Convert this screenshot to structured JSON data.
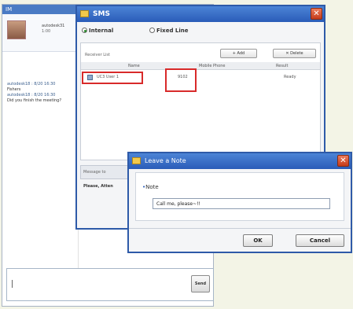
{
  "chat": {
    "title": "IM",
    "user_name": "autodesk31",
    "user_status": "1:00",
    "messages": [
      {
        "text": "autodesk18 : 8/20 16:30",
        "kind": "header"
      },
      {
        "text": "Fishers",
        "kind": "body"
      },
      {
        "text": "autodesk18 : 8/20 16:30",
        "kind": "header"
      },
      {
        "text": "Did you finish the meeting?",
        "kind": "body"
      }
    ],
    "input_value": "",
    "send_label": "Send"
  },
  "sms": {
    "title": "SMS",
    "close_glyph": "✕",
    "radio_internal": "Internal",
    "radio_fixed": "Fixed Line",
    "receiver_list_label": "Receiver List",
    "add_label": "+ Add",
    "delete_label": "✕ Delete",
    "columns": [
      "Name",
      "Mobile Phone",
      "Result"
    ],
    "rows": [
      {
        "name": "UC3 User 1",
        "phone": "9102",
        "result": "Ready"
      }
    ],
    "message_tab": "Message to",
    "note_text": "Please, Atten"
  },
  "note_dialog": {
    "title": "Leave a Note",
    "close_glyph": "✕",
    "note_label": "Note",
    "note_value": "Call me, please~!!",
    "ok_label": "OK",
    "cancel_label": "Cancel"
  },
  "colors": {
    "titlebar": "#2a5cb8",
    "highlight": "#d82a2a"
  }
}
